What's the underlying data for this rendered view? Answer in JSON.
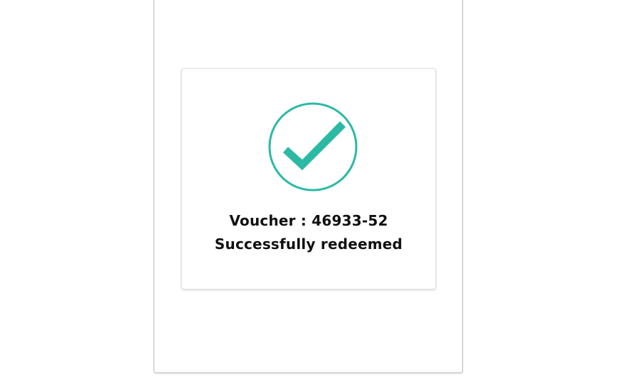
{
  "dialog": {
    "icon": "check-circle-icon",
    "accent_color": "#2bb9a4",
    "voucher_label": "Voucher : 46933-52",
    "status_text": "Successfully redeemed"
  }
}
